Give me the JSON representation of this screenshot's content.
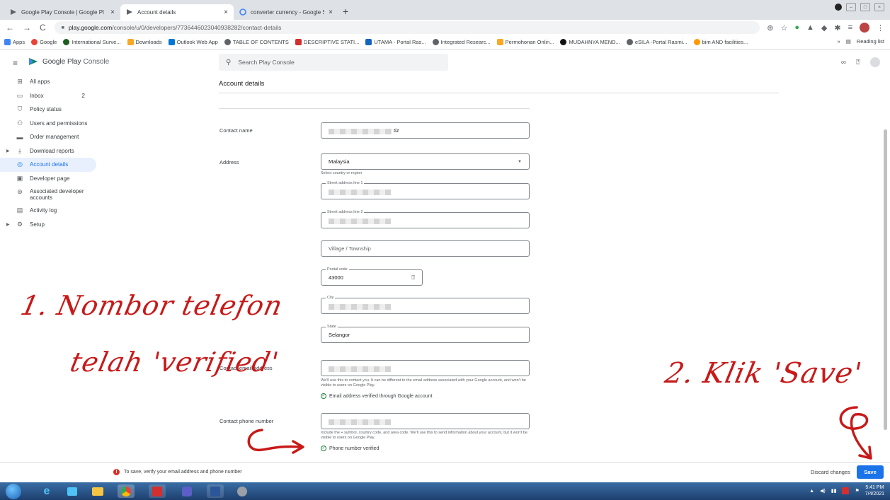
{
  "browser": {
    "tabs": [
      {
        "title": "Google Play Console | Google Pl",
        "close": "×"
      },
      {
        "title": "Account details",
        "close": "×"
      },
      {
        "title": "converter currency - Google Sea",
        "close": "×"
      }
    ],
    "new_tab": "+",
    "url_domain": "play.google.com",
    "url_path": "/console/u/0/developers/7736446023040938282/contact-details",
    "bookmarks": [
      "Apps",
      "Google",
      "International Surve...",
      "Downloads",
      "Outlook Web App",
      "TABLE OF CONTENTS",
      "DESCRIPTIVE STATI...",
      "UTAMA - Portal Ras...",
      "Integrated Researc...",
      "Permohonan Onlin...",
      "MUDAHNYA MEND...",
      "eSILA -Portal Rasmi...",
      "bim AND facilities..."
    ],
    "reading_list": "Reading list",
    "more": "»"
  },
  "console": {
    "logo_text_1": "Google Play",
    "logo_text_2": "Console",
    "search_placeholder": "Search Play Console"
  },
  "sidebar": {
    "items": [
      {
        "label": "All apps",
        "icon": "grid-icon"
      },
      {
        "label": "Inbox",
        "icon": "inbox-icon",
        "badge": "2"
      },
      {
        "label": "Policy status",
        "icon": "shield-check-icon"
      },
      {
        "label": "Users and permissions",
        "icon": "users-icon"
      },
      {
        "label": "Order management",
        "icon": "card-icon"
      },
      {
        "label": "Download reports",
        "icon": "download-icon"
      },
      {
        "label": "Account details",
        "icon": "account-icon"
      },
      {
        "label": "Developer page",
        "icon": "page-icon"
      },
      {
        "label": "Associated developer accounts",
        "icon": "link-icon"
      },
      {
        "label": "Activity log",
        "icon": "log-icon"
      },
      {
        "label": "Setup",
        "icon": "gear-icon"
      }
    ]
  },
  "main": {
    "title": "Account details",
    "contact_name_label": "Contact name",
    "contact_name_suffix": "tiz",
    "address_label": "Address",
    "country_value": "Malaysia",
    "country_helper": "Select country or region",
    "street1_legend": "Street address line 1",
    "street2_legend": "Street address line 2",
    "village_placeholder": "Village / Township",
    "postal_legend": "Postal code",
    "postal_value": "43000",
    "city_legend": "City",
    "state_legend": "State",
    "state_value": "Selangor",
    "email_label": "Contact email address",
    "email_helper": "We'll use this to contact you. It can be different to the email address associated with your Google account, and won't be visible to users on Google Play.",
    "email_verified": "Email address verified through Google account",
    "phone_label": "Contact phone number",
    "phone_helper": "Include the + symbol, country code, and area code. We'll use this to send information about your account, but it won't be visible to users on Google Play.",
    "phone_verified": "Phone number verified"
  },
  "savebar": {
    "warning": "To save, verify your email address and phone number",
    "discard": "Discard changes",
    "save": "Save"
  },
  "taskbar": {
    "time": "5:41 PM",
    "date": "7/4/2021"
  },
  "annotations": {
    "line1": "1. Nombor telefon",
    "line2": "telah 'verified'",
    "line3": "2. Klik 'Save'"
  },
  "colors": {
    "accent": "#1a73e8",
    "annotation": "#c81919",
    "verified": "#188038",
    "error": "#d93025"
  }
}
